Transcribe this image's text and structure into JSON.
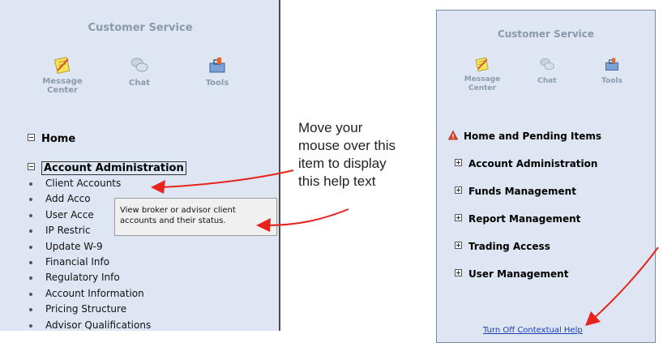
{
  "left_panel": {
    "title": "Customer Service",
    "toolbar": [
      {
        "label_line1": "Message",
        "label_line2": "Center",
        "icon": "notepad-icon"
      },
      {
        "label_line1": "Chat",
        "label_line2": "",
        "icon": "chat-bubbles-icon"
      },
      {
        "label_line1": "Tools",
        "label_line2": "",
        "icon": "toolbox-icon"
      }
    ],
    "home_label": "Home",
    "account_admin_label": "Account Administration",
    "sub_items": [
      "Client Accounts",
      "Add Acco",
      "User Acce",
      "IP Restric",
      "Update W-9",
      "Financial Info",
      "Regulatory Info",
      "Account Information",
      "Pricing Structure",
      "Advisor Qualifications"
    ],
    "tooltip_text": "View broker or advisor client accounts and their status."
  },
  "callout": {
    "line1": "Move your",
    "line2": "mouse over this",
    "line3": "item to display",
    "line4": "this help text"
  },
  "right_panel": {
    "title": "Customer Service",
    "toolbar": [
      {
        "label_line1": "Message",
        "label_line2": "Center",
        "icon": "notepad-icon"
      },
      {
        "label_line1": "Chat",
        "label_line2": "",
        "icon": "chat-bubbles-icon"
      },
      {
        "label_line1": "Tools",
        "label_line2": "",
        "icon": "toolbox-icon"
      }
    ],
    "sections": [
      "Home and Pending Items",
      "Account Administration",
      "Funds Management",
      "Report Management",
      "Trading Access",
      "User Management"
    ],
    "contextual_help_link": "Turn Off Contextual Help"
  },
  "colors": {
    "panel_bg": "#dde6f2",
    "muted_text": "#8b9aac",
    "arrow": "#e8231c",
    "link": "#1a3db8"
  }
}
